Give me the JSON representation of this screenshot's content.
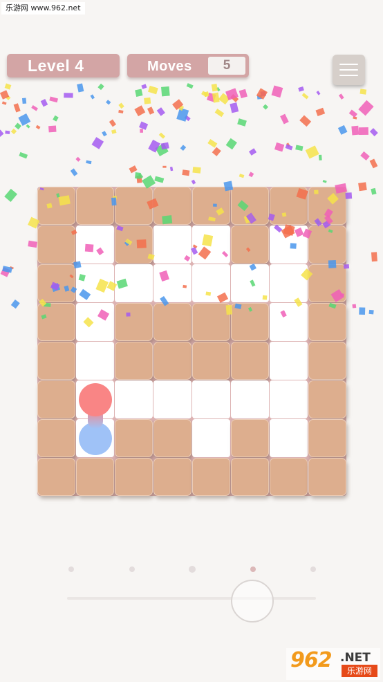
{
  "watermark_top": "乐游网 www.962.net",
  "header": {
    "level_label": "Level 4",
    "moves_label": "Moves",
    "moves_value": "5"
  },
  "board": {
    "rows": 8,
    "cols": 8,
    "grid": [
      "########",
      "#.#..#.#",
      "#......#",
      "#.####.#",
      "#.####.#",
      "#......#",
      "#.##.#.#",
      "########"
    ]
  },
  "balls": [
    {
      "name": "red-ball",
      "color": "#f98585",
      "row": 5,
      "col": 1
    },
    {
      "name": "blue-ball",
      "color": "#9fc2f7",
      "row": 6,
      "col": 1
    }
  ],
  "level_dots": {
    "count": 5,
    "current": 4
  },
  "colors": {
    "wall": "#ddae8e",
    "header_pill": "#d3a5a5",
    "confetti": [
      "#f36e4c",
      "#f6e34a",
      "#58d773",
      "#4a97ec",
      "#a55af0",
      "#f05fb7"
    ]
  },
  "logo": {
    "big": "962",
    "net": ".NET",
    "sub": "乐游网"
  }
}
